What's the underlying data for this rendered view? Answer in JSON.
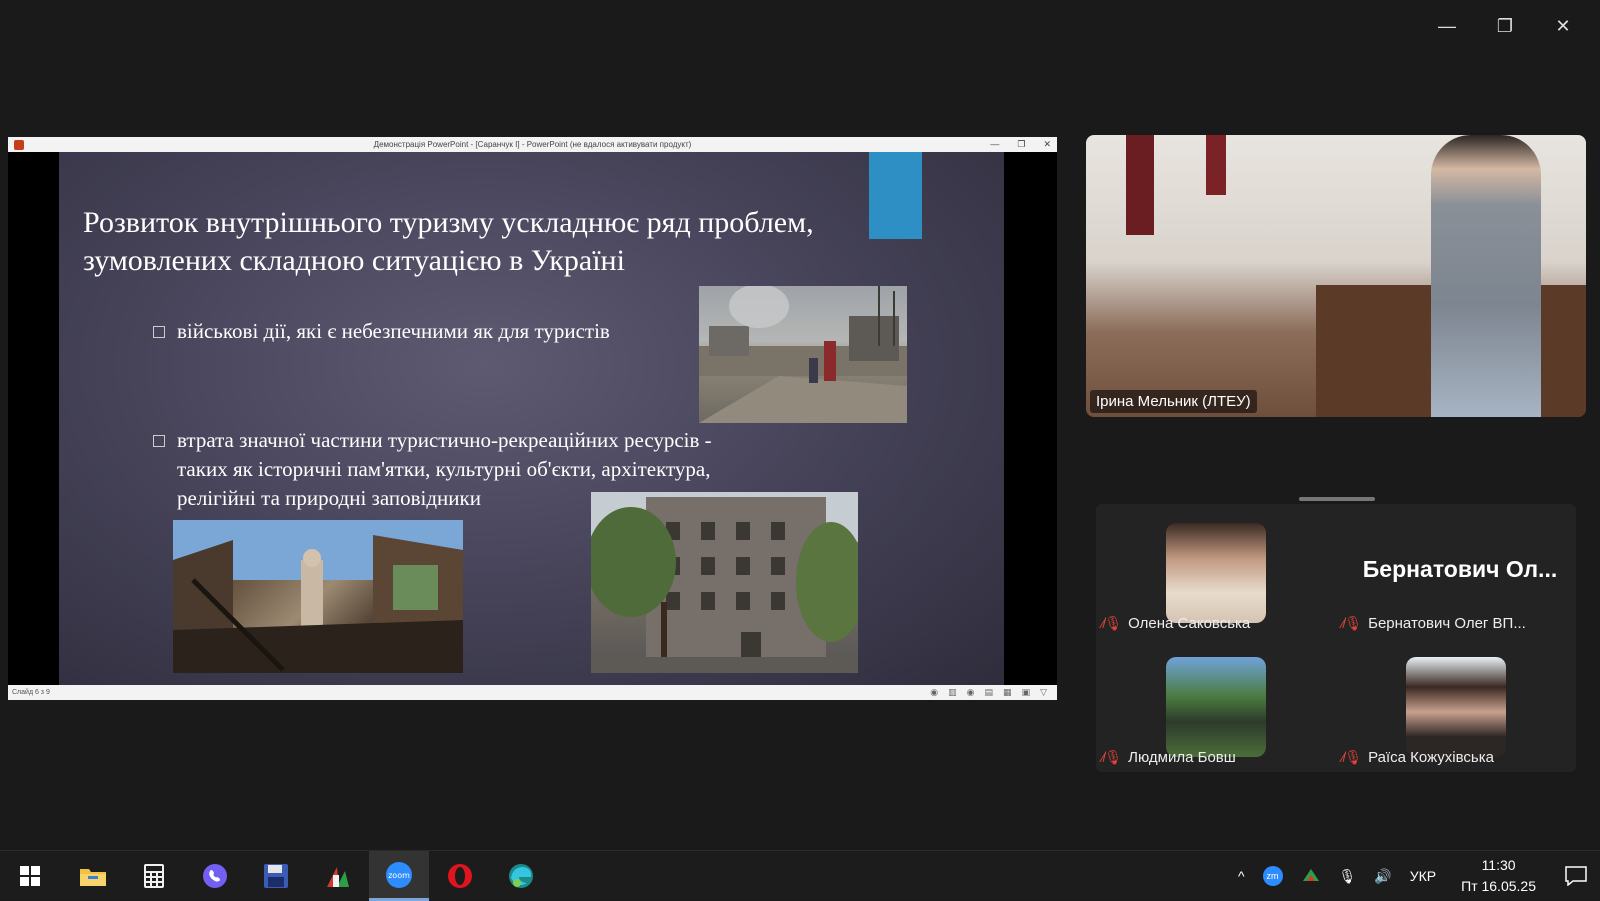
{
  "window": {
    "controls": [
      "—",
      "❐",
      "✕"
    ]
  },
  "powerpoint": {
    "window_title": "Демонстрація PowerPoint - [Саранчук І] - PowerPoint (не вдалося активувати продукт)",
    "controls": [
      "—",
      "❐",
      "✕"
    ],
    "status": "Слайд 6 з 9",
    "status_icons": [
      "◉",
      "▥",
      "◉",
      "▤",
      "▦",
      "▣",
      "▽"
    ]
  },
  "slide": {
    "title_line1": "Розвиток  внутрішнього туризму ускладнює ряд проблем,",
    "title_line2": "зумовлених складною ситуацією в Україні",
    "bullet1": "військові дії, які є небезпечними як для туристів",
    "bullet2_line1": "втрата  значної  частини  туристично-рекреаційних  ресурсів -",
    "bullet2_line2": "таких як  історичні пам'ятки, культурні об'єкти, архітектура,",
    "bullet2_line3": "релігійні  та  природні  заповідники",
    "accent_color": "#2e8fc4"
  },
  "speaker": {
    "name": "Ірина Мельник  (ЛТЕУ)"
  },
  "participants": [
    {
      "name": "Олена Саковська",
      "muted": true,
      "has_video_avatar": true
    },
    {
      "name": "Бернатович Олег ВП...",
      "display_name": "Бернатович  Ол...",
      "muted": true,
      "has_video_avatar": false
    },
    {
      "name": "Людмила Бовш",
      "muted": true,
      "has_video_avatar": true
    },
    {
      "name": "Раїса Кожухівська",
      "muted": true,
      "has_video_avatar": true
    }
  ],
  "taskbar": {
    "apps": [
      "windows-start",
      "file-explorer",
      "calculator",
      "viber",
      "save-disk",
      "chart-app",
      "zoom",
      "opera",
      "edge"
    ],
    "zoom_label": "zoom",
    "tray": {
      "chevron": "^",
      "zm": "zm",
      "mic": "🎙",
      "volume": "🔊",
      "language": "УКР"
    },
    "time": "11:30",
    "date": "Пт 16.05.25"
  }
}
